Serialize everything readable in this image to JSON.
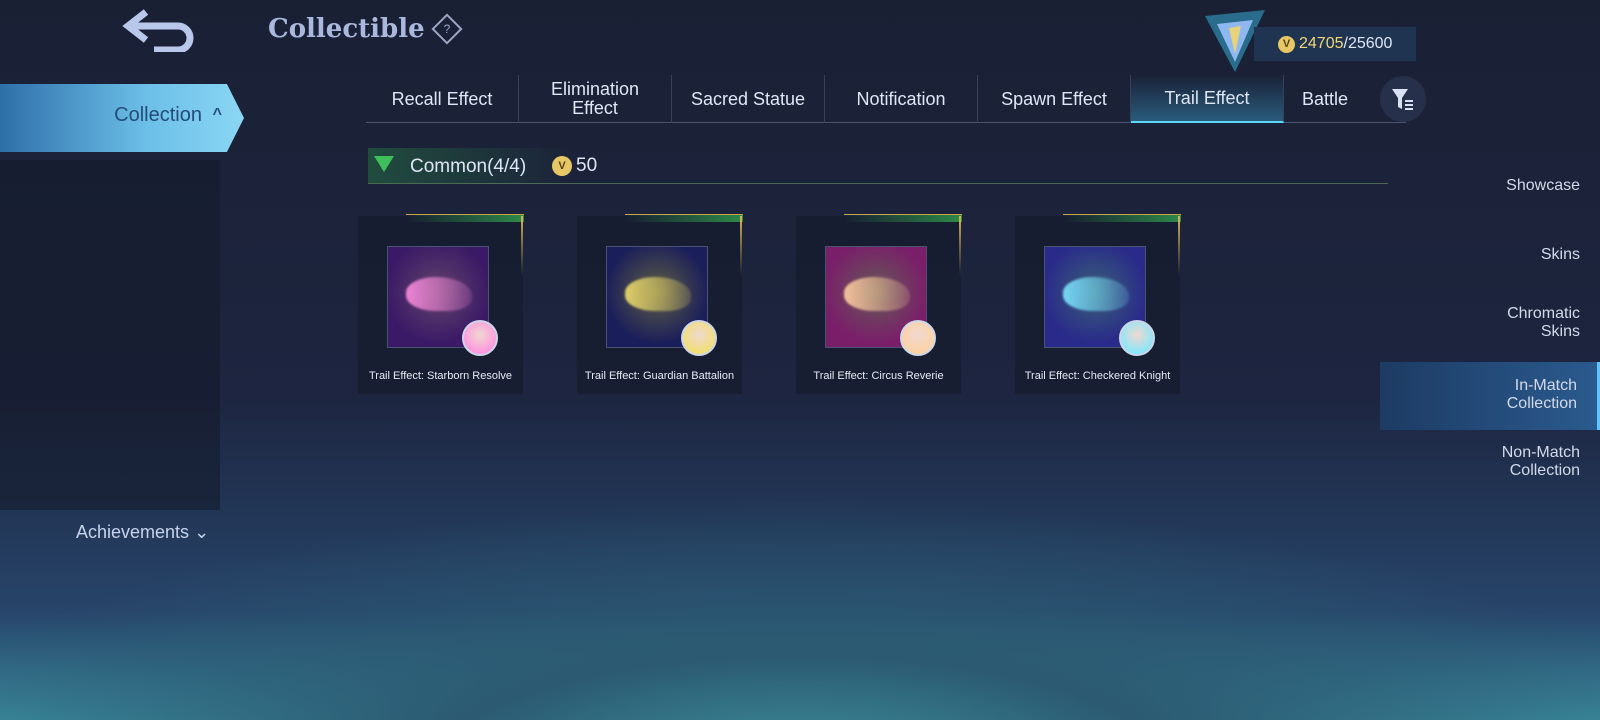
{
  "header": {
    "title": "Collectible",
    "help": "?"
  },
  "currency": {
    "current": "24705",
    "max": "/25600",
    "coin_icon": "battle-point-coin-icon"
  },
  "sidebar": {
    "collection": "Collection",
    "items": [
      "Showcase",
      "Skins",
      "Chromatic Skins",
      "In-Match Collection",
      "Non-Match Collection"
    ],
    "selected": "In-Match Collection",
    "achievements": "Achievements"
  },
  "tabs": [
    "Recall Effect",
    "Elimination Effect",
    "Sacred Statue",
    "Notification",
    "Spawn Effect",
    "Trail Effect",
    "Battle"
  ],
  "selected_tab": "Trail Effect",
  "section": {
    "label": "Common(4/4)",
    "points": "50"
  },
  "items": [
    {
      "name": "Trail Effect: Starborn Resolve",
      "bg": "#3a1a66",
      "glow": "#ff8fe0"
    },
    {
      "name": "Trail Effect: Guardian Battalion",
      "bg": "#1a1e5a",
      "glow": "#f2e06a"
    },
    {
      "name": "Trail Effect: Circus Reverie",
      "bg": "#7a1e6a",
      "glow": "#ffd2a0"
    },
    {
      "name": "Trail Effect: Checkered Knight",
      "bg": "#2a2a8a",
      "glow": "#7ee8ff"
    }
  ]
}
